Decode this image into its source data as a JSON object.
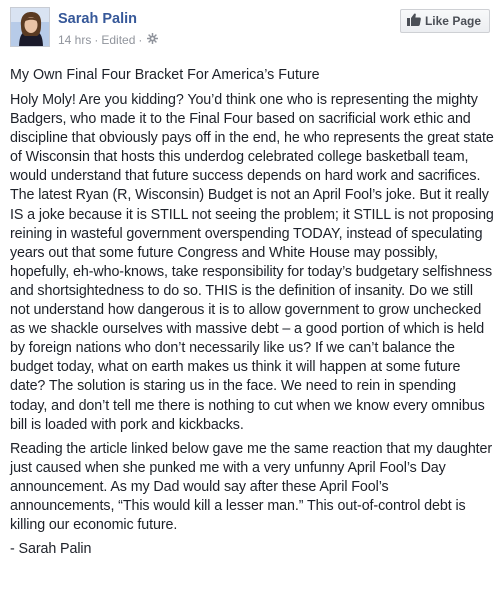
{
  "author": {
    "name": "Sarah Palin"
  },
  "meta": {
    "time": "14 hrs",
    "separator": "·",
    "edited": "Edited",
    "separator2": "·",
    "privacy_icon": "settings-gear-icon"
  },
  "like_button": {
    "label": "Like Page",
    "icon": "thumbs-up-icon"
  },
  "post": {
    "title": "My Own Final Four Bracket For America’s Future",
    "paragraph1": "Holy Moly! Are you kidding? You’d think one who is representing the mighty Badgers, who made it to the Final Four based on sacrificial work ethic and discipline that obviously pays off in the end, he who represents the great state of Wisconsin that hosts this underdog celebrated college basketball team, would understand that future success depends on hard work and sacrifices. The latest Ryan (R, Wisconsin) Budget is not an April Fool’s joke. But it really IS a joke because it is STILL not seeing the problem; it STILL is not proposing reining in wasteful government overspending TODAY, instead of speculating years out that some future Congress and White House may possibly, hopefully, eh-who-knows, take responsibility for today’s budgetary selfishness and shortsightedness to do so. THIS is the definition of insanity. Do we still not understand how dangerous it is to allow government to grow unchecked as we shackle ourselves with massive debt – a good portion of which is held by foreign nations who don’t necessarily like us? If we can’t balance the budget today, what on earth makes us think it will happen at some future date? The solution is staring us in the face. We need to rein in spending today, and don’t tell me there is nothing to cut when we know every omnibus bill is loaded with pork and kickbacks.",
    "paragraph2": "Reading the article linked below gave me the same reaction that my daughter just caused when she punked me with a very unfunny April Fool’s Day announcement. As my Dad would say after these April Fool’s announcements, “This would kill a lesser man.” This out-of-control debt is killing our economic future.",
    "signature": "- Sarah Palin"
  },
  "colors": {
    "link": "#365899",
    "meta": "#90949c",
    "text": "#1d2129"
  }
}
